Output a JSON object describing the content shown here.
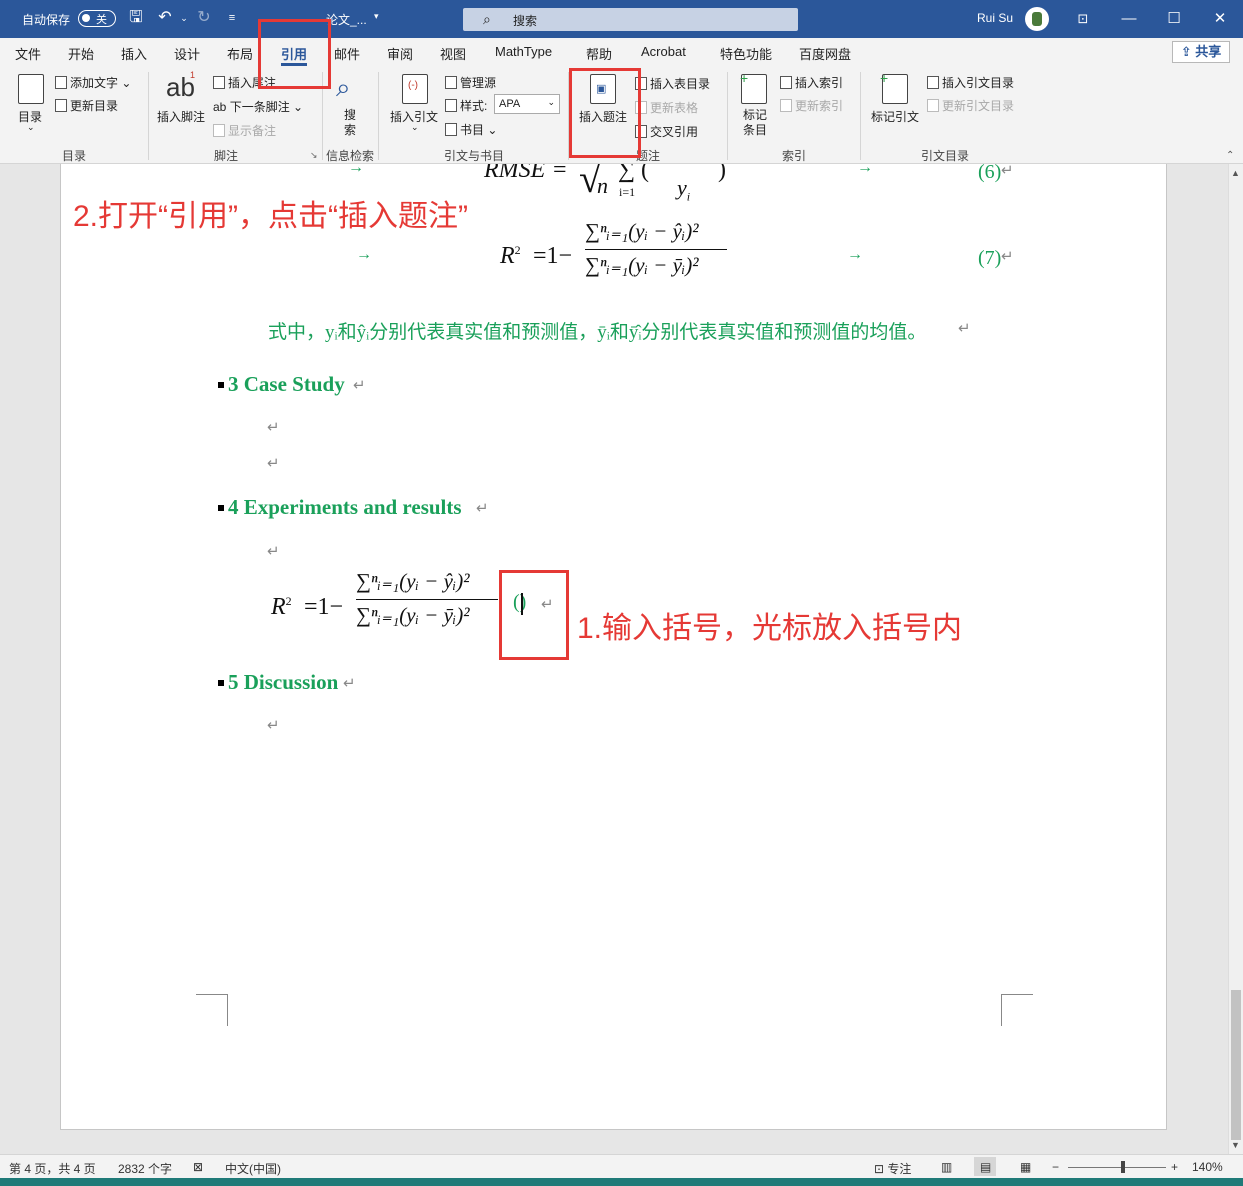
{
  "titlebar": {
    "autosave_label": "自动保存",
    "autosave_state": "关",
    "doc_title": "论文_...",
    "search_placeholder": "搜索",
    "user_name": "Rui Su"
  },
  "tabs": [
    "文件",
    "开始",
    "插入",
    "设计",
    "布局",
    "引用",
    "邮件",
    "审阅",
    "视图",
    "MathType",
    "帮助",
    "Acrobat",
    "特色功能",
    "百度网盘"
  ],
  "active_tab": "引用",
  "share_label": "共享",
  "ribbon": {
    "toc": {
      "button": "目录",
      "add_text": "添加文字",
      "update_toc": "更新目录",
      "group": "目录"
    },
    "footnotes": {
      "insert_footnote": "插入脚注",
      "insert_endnote": "插入尾注",
      "next_footnote": "下一条脚注",
      "show_notes": "显示备注",
      "group": "脚注"
    },
    "research": {
      "search": "搜索",
      "group": "信息检索"
    },
    "citations": {
      "insert_citation": "插入引文",
      "manage_sources": "管理源",
      "style_label": "样式:",
      "style_value": "APA",
      "bibliography": "书目",
      "group": "引文与书目"
    },
    "captions": {
      "insert_caption": "插入题注",
      "insert_tof": "插入表目录",
      "update_table": "更新表格",
      "cross_reference": "交叉引用",
      "group": "题注"
    },
    "index": {
      "mark_entry": "标记条目",
      "insert_index": "插入索引",
      "update_index": "更新索引",
      "group": "索引"
    },
    "toa": {
      "mark_citation": "标记引文",
      "insert_toa": "插入引文目录",
      "update_toa": "更新引文目录",
      "group": "引文目录"
    }
  },
  "document": {
    "annotation_top": "2.打开“引用”，点击“插入题注”",
    "annotation_bottom": "1.输入括号，光标放入括号内",
    "eq6_number": "(6)",
    "eq7_number": "(7)",
    "explanation": "式中，yᵢ和ŷᵢ分别代表真实值和预测值，ȳᵢ和ȳ̂ᵢ分别代表真实值和预测值的均值。",
    "heading3": "3 Case Study",
    "heading4": "4 Experiments and results",
    "heading5": "5 Discussion",
    "rmse_text": "RMSE",
    "r2_lhs": "R² = 1 −",
    "r2_num": "∑ⁿᵢ₌₁(yᵢ − ŷᵢ)²",
    "r2_den": "∑ⁿᵢ₌₁(yᵢ − ȳᵢ)²",
    "cursor_parens": "()"
  },
  "status": {
    "page": "第 4 页，共 4 页",
    "words": "2832 个字",
    "language": "中文(中国)",
    "focus": "专注",
    "zoom": "140%",
    "zoom_minus": "−",
    "zoom_plus": "+"
  }
}
